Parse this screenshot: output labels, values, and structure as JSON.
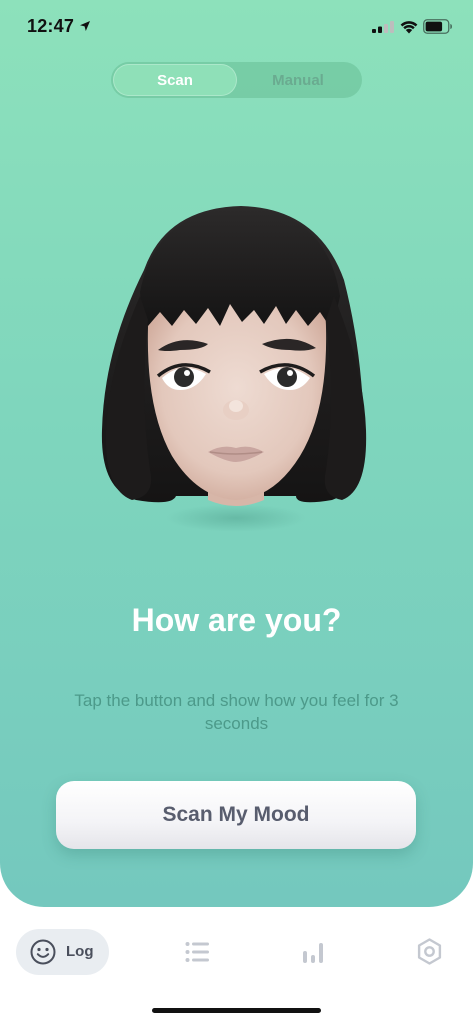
{
  "status_bar": {
    "time": "12:47"
  },
  "segmented_control": {
    "options": [
      "Scan",
      "Manual"
    ],
    "selected": "Scan"
  },
  "main": {
    "heading": "How are you?",
    "subtitle": "Tap the button and show how you feel for 3 seconds",
    "scan_button_label": "Scan My Mood"
  },
  "tab_bar": {
    "items": [
      {
        "label": "Log",
        "icon": "smiley-face-icon",
        "selected": true
      },
      {
        "label": "",
        "icon": "list-icon"
      },
      {
        "label": "",
        "icon": "bar-chart-icon"
      },
      {
        "label": "",
        "icon": "gear-icon"
      }
    ]
  },
  "colors": {
    "gradient_top": "#8de1bb",
    "gradient_bottom": "#74c8be",
    "heading": "#ffffff",
    "subtitle": "#4c9a8a",
    "button_text": "#585d6e",
    "tab_selected_bg": "#e9edf1"
  }
}
